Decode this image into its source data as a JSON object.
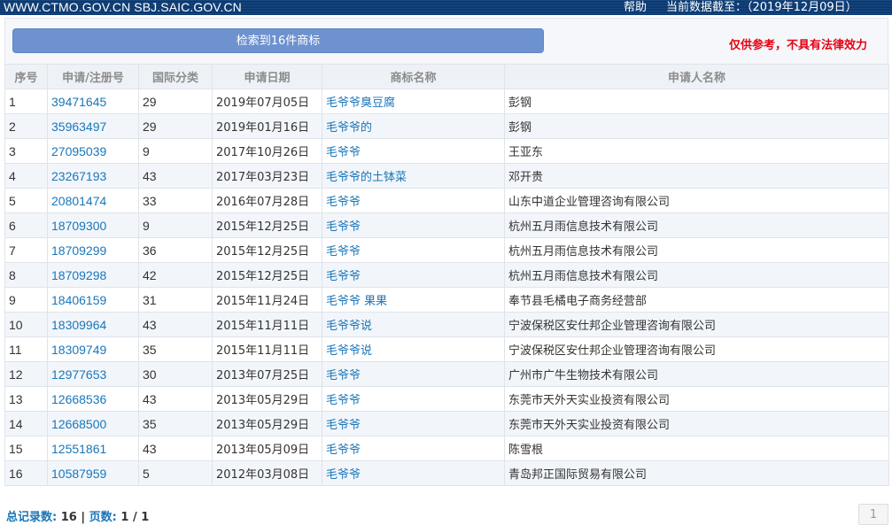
{
  "header": {
    "site_text": "WWW.CTMO.GOV.CN SBJ.SAIC.GOV.CN",
    "help_label": "帮助",
    "data_date": "当前数据截至：（2019年12月09日）"
  },
  "panel": {
    "result_label": "检索到16件商标",
    "disclaimer": "仅供参考，不具有法律效力"
  },
  "table": {
    "columns": [
      "序号",
      "申请/注册号",
      "国际分类",
      "申请日期",
      "商标名称",
      "申请人名称"
    ],
    "rows": [
      [
        "1",
        "39471645",
        "29",
        "2019年07月05日",
        "毛爷爷臭豆腐",
        "彭钢"
      ],
      [
        "2",
        "35963497",
        "29",
        "2019年01月16日",
        "毛爷爷的",
        "彭钢"
      ],
      [
        "3",
        "27095039",
        "9",
        "2017年10月26日",
        "毛爷爷",
        "王亚东"
      ],
      [
        "4",
        "23267193",
        "43",
        "2017年03月23日",
        "毛爷爷的土钵菜",
        "邓开贵"
      ],
      [
        "5",
        "20801474",
        "33",
        "2016年07月28日",
        "毛爷爷",
        "山东中道企业管理咨询有限公司"
      ],
      [
        "6",
        "18709300",
        "9",
        "2015年12月25日",
        "毛爷爷",
        "杭州五月雨信息技术有限公司"
      ],
      [
        "7",
        "18709299",
        "36",
        "2015年12月25日",
        "毛爷爷",
        "杭州五月雨信息技术有限公司"
      ],
      [
        "8",
        "18709298",
        "42",
        "2015年12月25日",
        "毛爷爷",
        "杭州五月雨信息技术有限公司"
      ],
      [
        "9",
        "18406159",
        "31",
        "2015年11月24日",
        "毛爷爷 果果",
        "奉节县毛橘电子商务经营部"
      ],
      [
        "10",
        "18309964",
        "43",
        "2015年11月11日",
        "毛爷爷说",
        "宁波保税区安仕邦企业管理咨询有限公司"
      ],
      [
        "11",
        "18309749",
        "35",
        "2015年11月11日",
        "毛爷爷说",
        "宁波保税区安仕邦企业管理咨询有限公司"
      ],
      [
        "12",
        "12977653",
        "30",
        "2013年07月25日",
        "毛爷爷",
        "广州市广牛生物技术有限公司"
      ],
      [
        "13",
        "12668536",
        "43",
        "2013年05月29日",
        "毛爷爷",
        "东莞市天外天实业投资有限公司"
      ],
      [
        "14",
        "12668500",
        "35",
        "2013年05月29日",
        "毛爷爷",
        "东莞市天外天实业投资有限公司"
      ],
      [
        "15",
        "12551861",
        "43",
        "2013年05月09日",
        "毛爷爷",
        "陈雪根"
      ],
      [
        "16",
        "10587959",
        "5",
        "2012年03月08日",
        "毛爷爷",
        "青岛邦正国际贸易有限公司"
      ]
    ]
  },
  "footer": {
    "total_label": "总记录数:",
    "total_value": "16",
    "separator": "|",
    "pages_label": "页数:",
    "pages_value": "1 / 1",
    "page_button": "1"
  }
}
